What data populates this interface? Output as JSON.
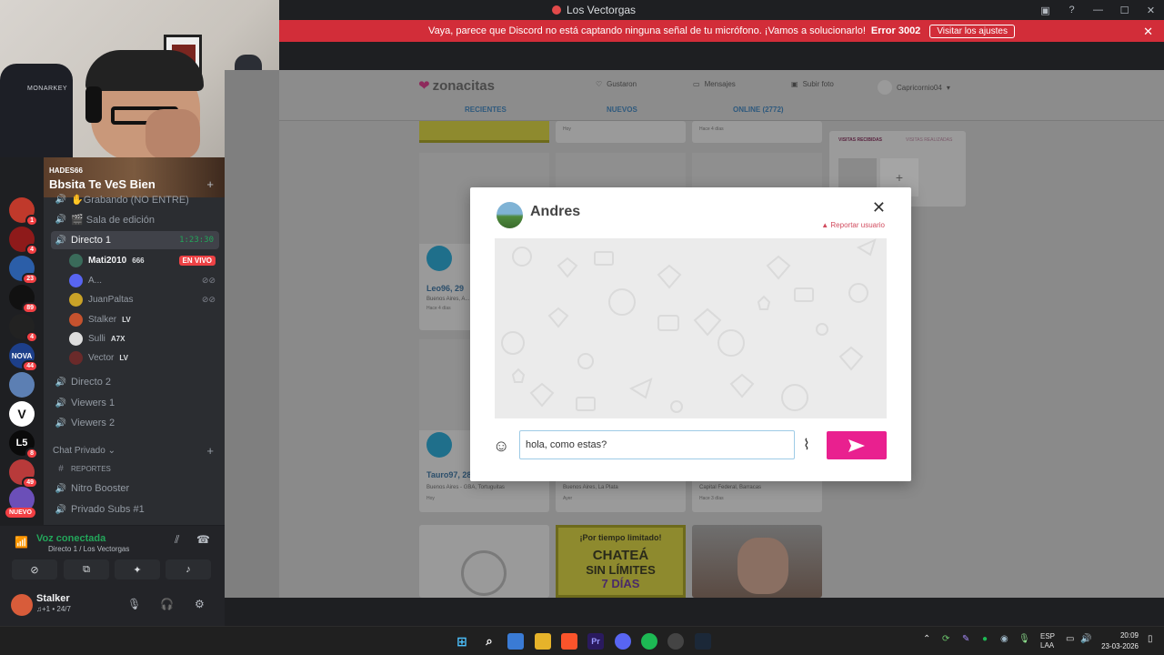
{
  "window": {
    "title": "Los Vectorgas"
  },
  "notice": {
    "text": "Vaya, parece que Discord no está captando ninguna señal de tu micrófono. ¡Vamos a solucionarlo!",
    "error": "Error 3002",
    "button": "Visitar los ajustes"
  },
  "webcam": {
    "chair_brand": "MONARKEY"
  },
  "servers": [
    {
      "badge": "1",
      "color": "#c0392b"
    },
    {
      "badge": "4",
      "color": "#8e1a1a"
    },
    {
      "badge": "23",
      "color": "#2b5ea8"
    },
    {
      "badge": "89",
      "color": "#111111"
    },
    {
      "badge": "4",
      "color": "#222222"
    },
    {
      "label": "NOVA",
      "badge": "44",
      "color": "#1d3f8a"
    },
    {
      "badge": "",
      "color": "#5c7fb3"
    },
    {
      "label": "V",
      "badge": "",
      "color": "#ffffff"
    },
    {
      "label": "L5",
      "badge": "8",
      "color": "#0a0a0a"
    },
    {
      "badge": "49",
      "color": "#b83a3a"
    },
    {
      "badge": "",
      "color": "#6b4fb8"
    }
  ],
  "server_new": "NUEVO",
  "guild": {
    "owner": "HADES66",
    "name": "Bbsita Te VeS Bien"
  },
  "channels": [
    {
      "name": "✋Grabando (NO ENTRE)"
    },
    {
      "name": "🎬 Sala de edición"
    },
    {
      "name": "Directo 1",
      "timer": "1:23:30"
    },
    {
      "name": "Directo 2"
    },
    {
      "name": "Viewers 1"
    },
    {
      "name": "Viewers 2"
    }
  ],
  "voice_users": [
    {
      "name": "Mati2010",
      "tag": "666",
      "status": "EN VIVO",
      "color": "#3a6b5a"
    },
    {
      "name": "A...",
      "tag": "",
      "color": "#5865f2"
    },
    {
      "name": "JuanPaltas",
      "tag": "",
      "color": "#c9a227"
    },
    {
      "name": "Stalker",
      "tag": "LV",
      "color": "#c5522e"
    },
    {
      "name": "Sulli",
      "tag": "A7X",
      "color": "#dddddd"
    },
    {
      "name": "Vector",
      "tag": "LV",
      "color": "#6a2a2a"
    }
  ],
  "private_category": "Chat Privado",
  "private_channels": [
    {
      "name": "REPORTES"
    },
    {
      "name": "Nitro Booster"
    },
    {
      "name": "Privado Subs #1"
    }
  ],
  "voice_panel": {
    "status": "Voz conectada",
    "location": "Directo 1 / Los Vectorgas"
  },
  "user_panel": {
    "name": "Stalker",
    "status": "♫+1 • 24/7"
  },
  "site": {
    "brand": "zonacitas",
    "nav": [
      "Gustaron",
      "Mensajes",
      "Subir foto",
      "Capricornio04"
    ],
    "tabs": [
      "RECIENTES",
      "NUEVOS",
      "ONLINE (2772)"
    ],
    "visits_tabs": [
      "VISITAS RECIBIDAS",
      "VISITAS REALIZADAS"
    ],
    "cards": [
      {
        "title": "Leo96, 29",
        "loc": "Buenos Aires, A...",
        "ago": "Hace 4 días"
      },
      {
        "title": "Tauro97, 28",
        "loc": "Buenos Aires - GBA, Tortuguitas",
        "ago": "Hoy"
      },
      {
        "loc": "Buenos Aires, La Plata",
        "ago": "Ayer"
      },
      {
        "loc": "Capital Federal, Barracas",
        "ago": "Hace 3 días"
      }
    ],
    "top_ago": [
      "Hoy",
      "Hace 4 días"
    ],
    "promo": {
      "line1": "¡Por tiempo limitado!",
      "line2": "CHATEÁ",
      "line3": "SIN LÍMITES",
      "line4": "7 DÍAS"
    }
  },
  "modal": {
    "user": "Andres",
    "report": "Reportar usuario",
    "message": "hola, como estas?"
  },
  "taskbar": {
    "lang1": "ESP",
    "lang2": "LAA",
    "time": "20:09",
    "date": "23-03-2026"
  }
}
